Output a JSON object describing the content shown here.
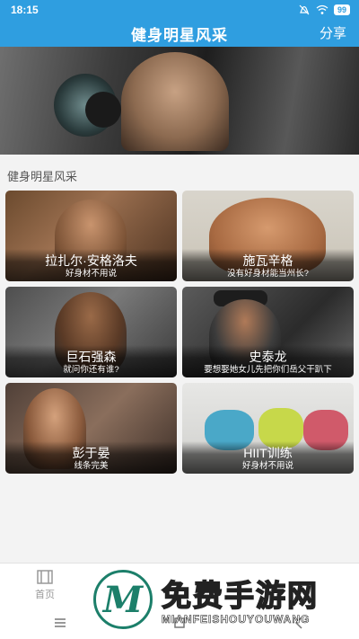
{
  "status": {
    "time": "18:15",
    "battery": "99"
  },
  "header": {
    "title": "健身明星风采",
    "share_label": "分享"
  },
  "section": {
    "title": "健身明星风采"
  },
  "cards": [
    {
      "name": "拉扎尔·安格洛夫",
      "sub": "好身材不用说"
    },
    {
      "name": "施瓦辛格",
      "sub": "没有好身材能当州长?"
    },
    {
      "name": "巨石强森",
      "sub": "就问你还有谁?"
    },
    {
      "name": "史泰龙",
      "sub": "要想娶她女儿先把你们岳父干趴下"
    },
    {
      "name": "彭于晏",
      "sub": "线条完美"
    },
    {
      "name": "HIIT训练",
      "sub": "好身材不用说"
    }
  ],
  "bottomnav": {
    "items": [
      {
        "label": "首页",
        "icon": "film-icon"
      }
    ]
  },
  "watermark": {
    "text": "免费手游网",
    "sub": "MIANFEISHOUYOUWANG",
    "letter": "M"
  },
  "colors": {
    "accent": "#2f9ee0",
    "watermark": "#1c7f6a"
  }
}
